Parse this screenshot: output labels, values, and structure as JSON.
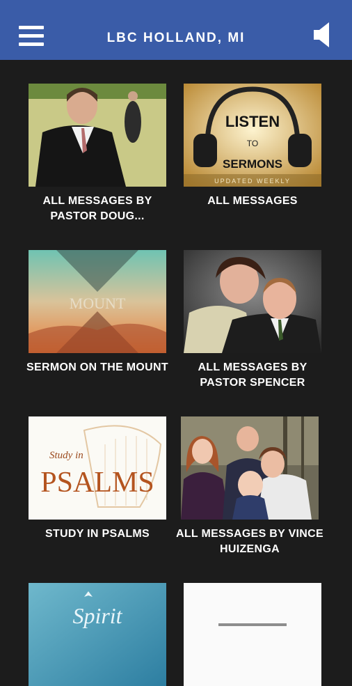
{
  "header": {
    "title": "LBC HOLLAND, MI",
    "menu_icon": "hamburger-menu-icon",
    "audio_icon": "speaker-icon",
    "background_color": "#3a5ca8"
  },
  "tiles": [
    {
      "label": "ALL MESSAGES BY PASTOR DOUG..."
    },
    {
      "label": "ALL MESSAGES",
      "art_text": {
        "line1": "LISTEN",
        "line2": "TO",
        "line3": "SERMONS",
        "footer": "UPDATED WEEKLY"
      }
    },
    {
      "label": "SERMON ON THE MOUNT",
      "art_text": {
        "main": "MOUNT"
      }
    },
    {
      "label": "ALL MESSAGES BY PASTOR SPENCER"
    },
    {
      "label": "STUDY IN PSALMS",
      "art_text": {
        "small": "Study in",
        "main": "PSALMS"
      }
    },
    {
      "label": "ALL MESSAGES BY VINCE HUIZENGA"
    },
    {
      "label": "",
      "art_text": {
        "main": "Spirit"
      }
    },
    {
      "label": ""
    }
  ]
}
